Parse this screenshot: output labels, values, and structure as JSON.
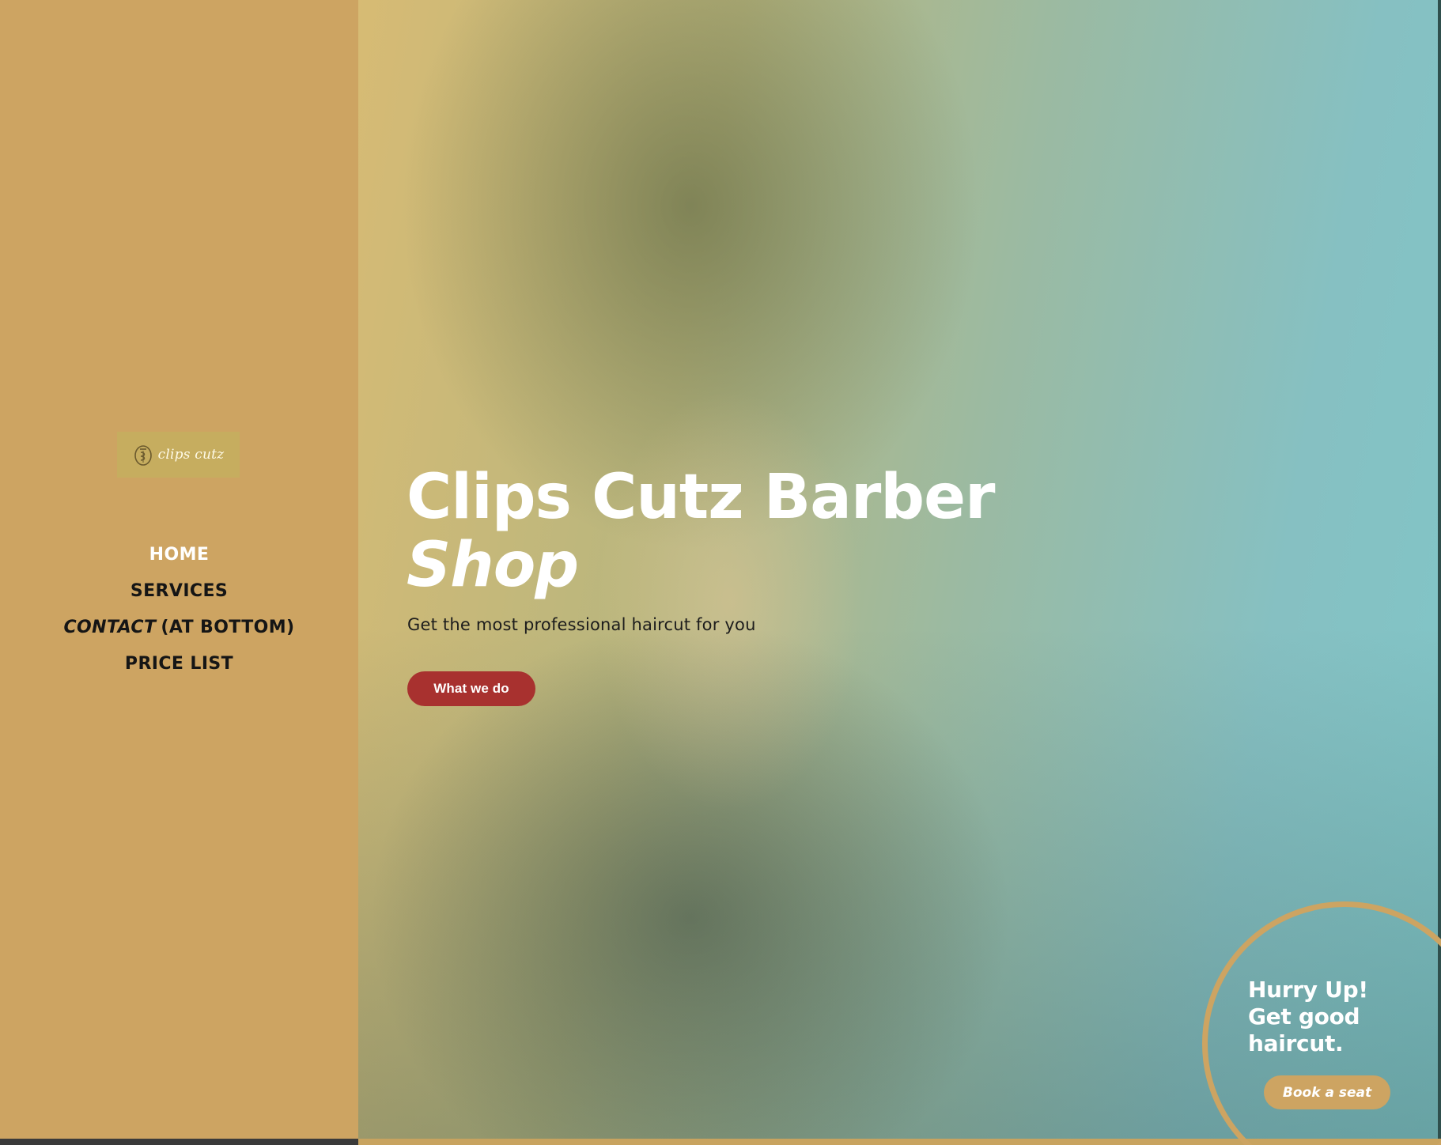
{
  "logo": {
    "text": "clips cutz",
    "icon": "comb-emblem-icon"
  },
  "nav": {
    "items": [
      {
        "label": "HOME",
        "active": true
      },
      {
        "label": "SERVICES",
        "active": false
      },
      {
        "label_em": "CONTACT",
        "label_rest": "(AT BOTTOM)",
        "active": false
      },
      {
        "label": "PRICE LIST",
        "active": false
      }
    ]
  },
  "hero": {
    "title_line1": "Clips Cutz Barber",
    "title_line2": "Shop",
    "subtitle": "Get the most professional haircut for you",
    "cta_label": "What we do"
  },
  "promo": {
    "line1": "Hurry Up!",
    "line2": "Get good",
    "line3": "haircut.",
    "button_label": "Book a seat"
  },
  "colors": {
    "sidebar": "#cda462",
    "cta": "#a8312f",
    "accent": "#cda462",
    "text_dark": "#151515"
  }
}
